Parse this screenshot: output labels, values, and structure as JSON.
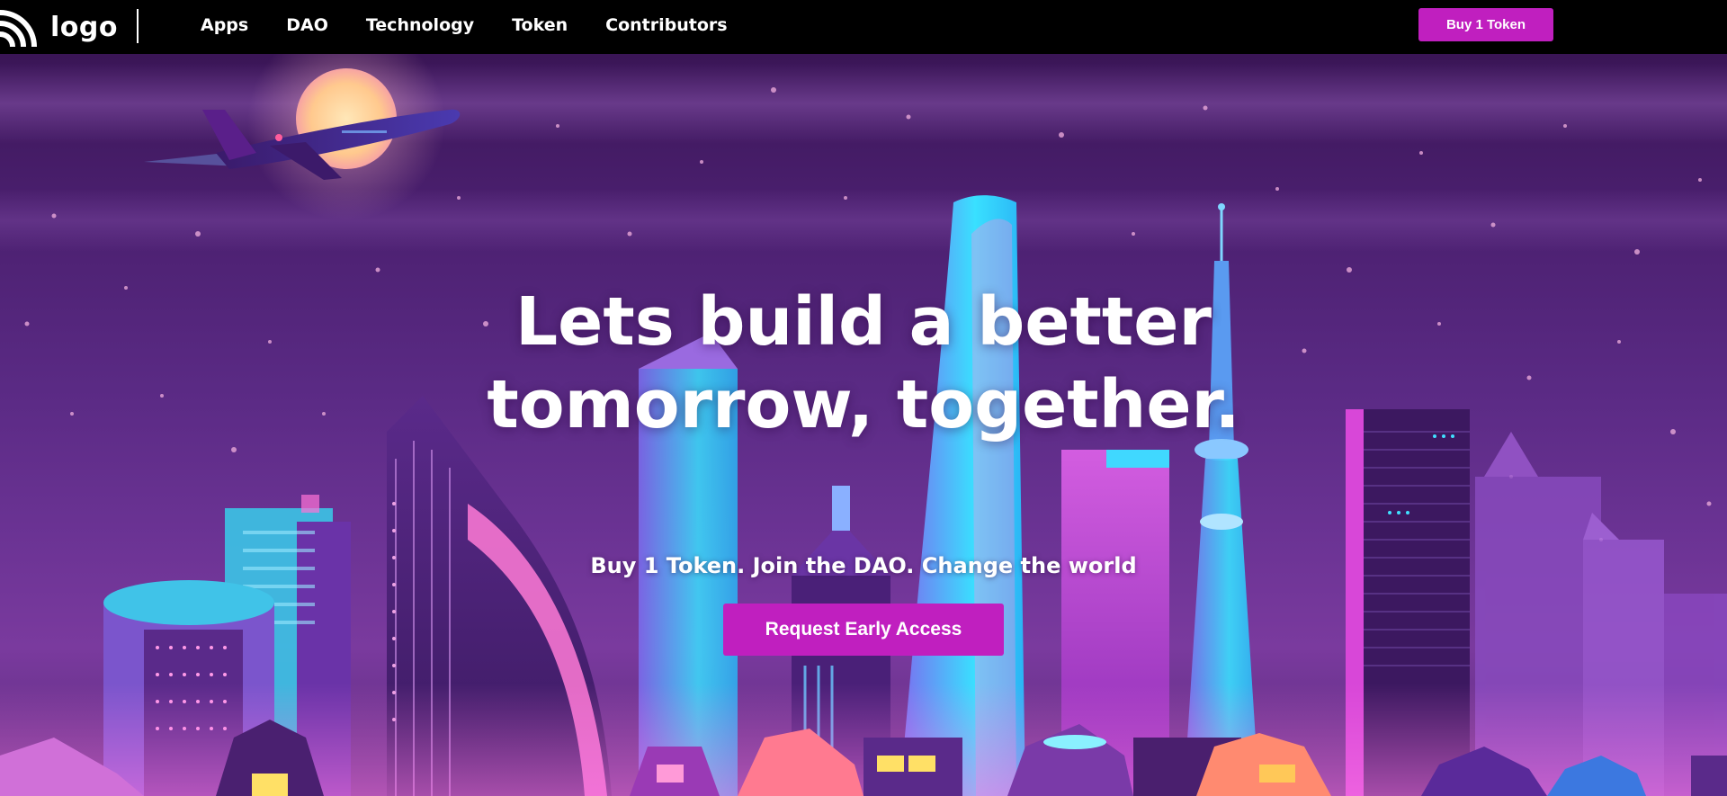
{
  "nav": {
    "logo_text": "logo",
    "links": [
      {
        "label": "Apps"
      },
      {
        "label": "DAO"
      },
      {
        "label": "Technology"
      },
      {
        "label": "Token"
      },
      {
        "label": "Contributors"
      }
    ],
    "buy_button_label": "Buy 1 Token"
  },
  "hero": {
    "headline_line1": "Lets build a better",
    "headline_line2": "tomorrow, together.",
    "subheadline": "Buy 1 Token. Join the DAO. Change the world",
    "cta_label": "Request Early Access"
  },
  "colors": {
    "accent": "#c01fbf",
    "navbar_bg": "#000000",
    "sky_top": "#3a1556",
    "sky_bottom": "#7a3a9e"
  },
  "icons": {
    "logo": "wifi-arcs-logo-icon"
  }
}
